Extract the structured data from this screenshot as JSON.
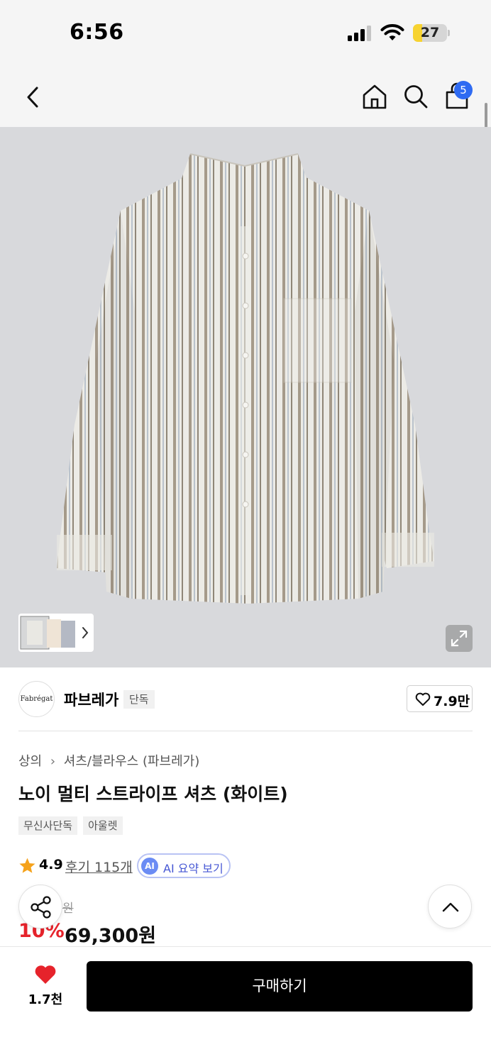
{
  "status_bar": {
    "time": "6:56",
    "battery": "27"
  },
  "nav": {
    "cart_count": "5"
  },
  "brand": {
    "logo_text": "Fabrégat",
    "name": "파브레가",
    "badge": "단독",
    "wish_count": "7.9만"
  },
  "breadcrumb": {
    "category": "상의",
    "subcategory": "셔츠/블라우스 (파브레가)"
  },
  "product": {
    "title": "노이 멀티 스트라이프 셔츠 (화이트)",
    "tags": [
      "무신사단독",
      "아울렛"
    ],
    "rating": "4.9",
    "review_text": "후기 115개",
    "ai_summary_label": "AI 요약 보기",
    "ai_badge": "AI",
    "original_price": "원",
    "discount": "10%",
    "price": "69,300원"
  },
  "bottom": {
    "like_count": "1.7천",
    "buy_label": "구매하기"
  },
  "colors": {
    "accent_blue": "#2f6bf2",
    "discount_red": "#e6232b",
    "buy_button": "#000000",
    "heart": "#e6232b"
  }
}
